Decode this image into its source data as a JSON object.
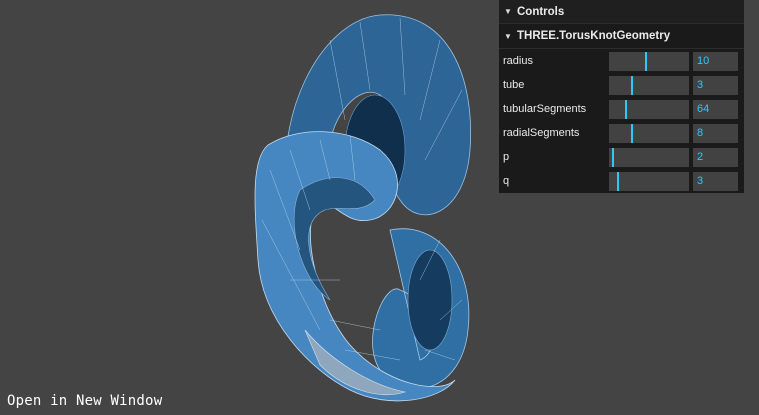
{
  "gui": {
    "title": "Controls",
    "folder": {
      "title": "THREE.TorusKnotGeometry",
      "params": [
        {
          "label": "radius",
          "value": "10",
          "fraction": 0.45
        },
        {
          "label": "tube",
          "value": "3",
          "fraction": 0.27
        },
        {
          "label": "tubularSegments",
          "value": "64",
          "fraction": 0.2
        },
        {
          "label": "radialSegments",
          "value": "8",
          "fraction": 0.27
        },
        {
          "label": "p",
          "value": "2",
          "fraction": 0.04
        },
        {
          "label": "q",
          "value": "3",
          "fraction": 0.1
        }
      ]
    }
  },
  "open_link": "Open in New Window",
  "colors": {
    "background": "#444444",
    "mesh": "#3d7bb4",
    "wire": "#b8d3ec",
    "accent": "#2cc9ff",
    "panel": "#1a1a1a"
  },
  "icons": {
    "collapse": "chevron-down-icon"
  }
}
